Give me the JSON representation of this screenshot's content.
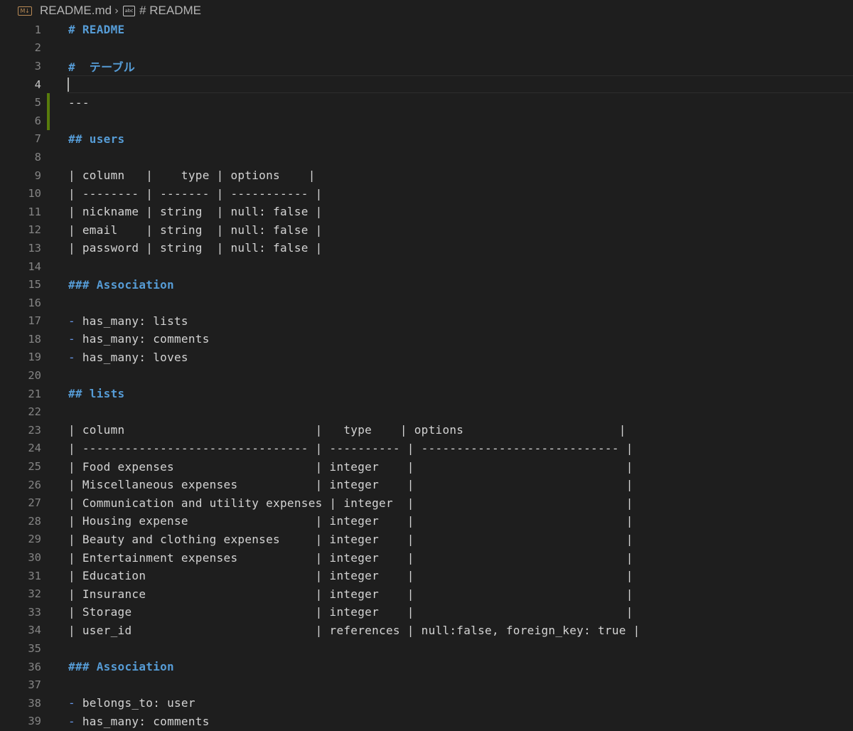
{
  "breadcrumb": {
    "file": "README.md",
    "symbol": "# README"
  },
  "editor": {
    "current_line": 4,
    "lines": [
      {
        "n": "1",
        "text": "# README",
        "kind": "heading"
      },
      {
        "n": "2",
        "text": "",
        "kind": "text"
      },
      {
        "n": "3",
        "text": "#  テーブル",
        "kind": "heading"
      },
      {
        "n": "4",
        "text": "",
        "kind": "text"
      },
      {
        "n": "5",
        "text": "---",
        "kind": "text"
      },
      {
        "n": "6",
        "text": "",
        "kind": "text"
      },
      {
        "n": "7",
        "text": "## users",
        "kind": "heading"
      },
      {
        "n": "8",
        "text": "",
        "kind": "text"
      },
      {
        "n": "9",
        "text": "| column   |    type | options    |",
        "kind": "text"
      },
      {
        "n": "10",
        "text": "| -------- | ------- | ----------- |",
        "kind": "text"
      },
      {
        "n": "11",
        "text": "| nickname | string  | null: false |",
        "kind": "text"
      },
      {
        "n": "12",
        "text": "| email    | string  | null: false |",
        "kind": "text"
      },
      {
        "n": "13",
        "text": "| password | string  | null: false |",
        "kind": "text"
      },
      {
        "n": "14",
        "text": "",
        "kind": "text"
      },
      {
        "n": "15",
        "text": "### Association",
        "kind": "heading"
      },
      {
        "n": "16",
        "text": "",
        "kind": "text"
      },
      {
        "n": "17",
        "bullet": "-",
        "text": " has_many: lists",
        "kind": "list"
      },
      {
        "n": "18",
        "bullet": "-",
        "text": " has_many: comments",
        "kind": "list"
      },
      {
        "n": "19",
        "bullet": "-",
        "text": " has_many: loves",
        "kind": "list"
      },
      {
        "n": "20",
        "text": "",
        "kind": "text"
      },
      {
        "n": "21",
        "text": "## lists",
        "kind": "heading"
      },
      {
        "n": "22",
        "text": "",
        "kind": "text"
      },
      {
        "n": "23",
        "text": "| column                           |   type    | options                      |",
        "kind": "text"
      },
      {
        "n": "24",
        "text": "| -------------------------------- | ---------- | ---------------------------- |",
        "kind": "text"
      },
      {
        "n": "25",
        "text": "| Food expenses                    | integer    |                              |",
        "kind": "text"
      },
      {
        "n": "26",
        "text": "| Miscellaneous expenses           | integer    |                              |",
        "kind": "text"
      },
      {
        "n": "27",
        "text": "| Communication and utility expenses | integer  |                              |",
        "kind": "text"
      },
      {
        "n": "28",
        "text": "| Housing expense                  | integer    |                              |",
        "kind": "text"
      },
      {
        "n": "29",
        "text": "| Beauty and clothing expenses     | integer    |                              |",
        "kind": "text"
      },
      {
        "n": "30",
        "text": "| Entertainment expenses           | integer    |                              |",
        "kind": "text"
      },
      {
        "n": "31",
        "text": "| Education                        | integer    |                              |",
        "kind": "text"
      },
      {
        "n": "32",
        "text": "| Insurance                        | integer    |                              |",
        "kind": "text"
      },
      {
        "n": "33",
        "text": "| Storage                          | integer    |                              |",
        "kind": "text"
      },
      {
        "n": "34",
        "text": "| user_id                          | references | null:false, foreign_key: true |",
        "kind": "text"
      },
      {
        "n": "35",
        "text": "",
        "kind": "text"
      },
      {
        "n": "36",
        "text": "### Association",
        "kind": "heading"
      },
      {
        "n": "37",
        "text": "",
        "kind": "text"
      },
      {
        "n": "38",
        "bullet": "-",
        "text": " belongs_to: user",
        "kind": "list"
      },
      {
        "n": "39",
        "bullet": "-",
        "text": " has_many: comments",
        "kind": "list"
      }
    ]
  },
  "colors": {
    "background": "#1e1e1e",
    "heading": "#569cd6",
    "text": "#d4d4d4",
    "line_number": "#858585",
    "gutter_modified": "#587c0c"
  },
  "icons": {
    "file": "markdown-file-icon",
    "symbol": "string-symbol-icon",
    "separator": "chevron-right-icon"
  }
}
